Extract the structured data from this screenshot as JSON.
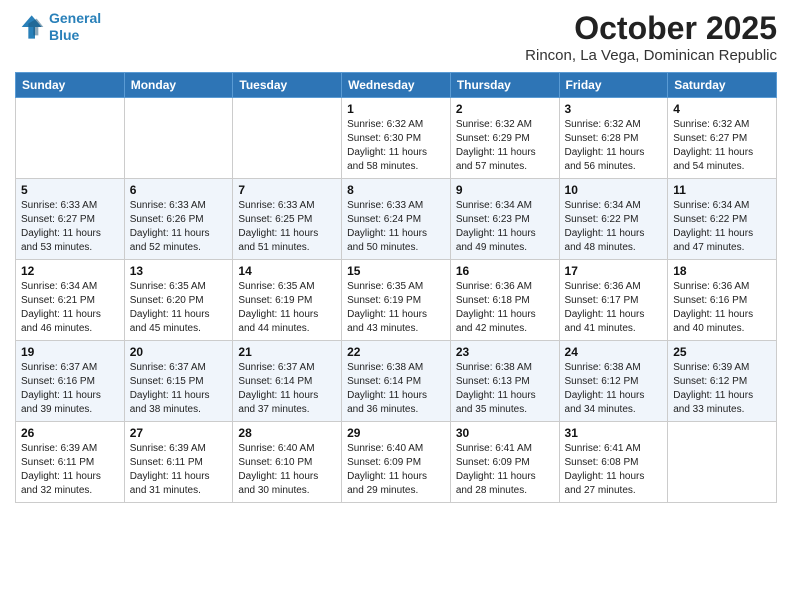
{
  "logo": {
    "line1": "General",
    "line2": "Blue"
  },
  "header": {
    "month": "October 2025",
    "location": "Rincon, La Vega, Dominican Republic"
  },
  "weekdays": [
    "Sunday",
    "Monday",
    "Tuesday",
    "Wednesday",
    "Thursday",
    "Friday",
    "Saturday"
  ],
  "weeks": [
    [
      {
        "day": "",
        "sunrise": "",
        "sunset": "",
        "daylight": ""
      },
      {
        "day": "",
        "sunrise": "",
        "sunset": "",
        "daylight": ""
      },
      {
        "day": "",
        "sunrise": "",
        "sunset": "",
        "daylight": ""
      },
      {
        "day": "1",
        "sunrise": "Sunrise: 6:32 AM",
        "sunset": "Sunset: 6:30 PM",
        "daylight": "Daylight: 11 hours and 58 minutes."
      },
      {
        "day": "2",
        "sunrise": "Sunrise: 6:32 AM",
        "sunset": "Sunset: 6:29 PM",
        "daylight": "Daylight: 11 hours and 57 minutes."
      },
      {
        "day": "3",
        "sunrise": "Sunrise: 6:32 AM",
        "sunset": "Sunset: 6:28 PM",
        "daylight": "Daylight: 11 hours and 56 minutes."
      },
      {
        "day": "4",
        "sunrise": "Sunrise: 6:32 AM",
        "sunset": "Sunset: 6:27 PM",
        "daylight": "Daylight: 11 hours and 54 minutes."
      }
    ],
    [
      {
        "day": "5",
        "sunrise": "Sunrise: 6:33 AM",
        "sunset": "Sunset: 6:27 PM",
        "daylight": "Daylight: 11 hours and 53 minutes."
      },
      {
        "day": "6",
        "sunrise": "Sunrise: 6:33 AM",
        "sunset": "Sunset: 6:26 PM",
        "daylight": "Daylight: 11 hours and 52 minutes."
      },
      {
        "day": "7",
        "sunrise": "Sunrise: 6:33 AM",
        "sunset": "Sunset: 6:25 PM",
        "daylight": "Daylight: 11 hours and 51 minutes."
      },
      {
        "day": "8",
        "sunrise": "Sunrise: 6:33 AM",
        "sunset": "Sunset: 6:24 PM",
        "daylight": "Daylight: 11 hours and 50 minutes."
      },
      {
        "day": "9",
        "sunrise": "Sunrise: 6:34 AM",
        "sunset": "Sunset: 6:23 PM",
        "daylight": "Daylight: 11 hours and 49 minutes."
      },
      {
        "day": "10",
        "sunrise": "Sunrise: 6:34 AM",
        "sunset": "Sunset: 6:22 PM",
        "daylight": "Daylight: 11 hours and 48 minutes."
      },
      {
        "day": "11",
        "sunrise": "Sunrise: 6:34 AM",
        "sunset": "Sunset: 6:22 PM",
        "daylight": "Daylight: 11 hours and 47 minutes."
      }
    ],
    [
      {
        "day": "12",
        "sunrise": "Sunrise: 6:34 AM",
        "sunset": "Sunset: 6:21 PM",
        "daylight": "Daylight: 11 hours and 46 minutes."
      },
      {
        "day": "13",
        "sunrise": "Sunrise: 6:35 AM",
        "sunset": "Sunset: 6:20 PM",
        "daylight": "Daylight: 11 hours and 45 minutes."
      },
      {
        "day": "14",
        "sunrise": "Sunrise: 6:35 AM",
        "sunset": "Sunset: 6:19 PM",
        "daylight": "Daylight: 11 hours and 44 minutes."
      },
      {
        "day": "15",
        "sunrise": "Sunrise: 6:35 AM",
        "sunset": "Sunset: 6:19 PM",
        "daylight": "Daylight: 11 hours and 43 minutes."
      },
      {
        "day": "16",
        "sunrise": "Sunrise: 6:36 AM",
        "sunset": "Sunset: 6:18 PM",
        "daylight": "Daylight: 11 hours and 42 minutes."
      },
      {
        "day": "17",
        "sunrise": "Sunrise: 6:36 AM",
        "sunset": "Sunset: 6:17 PM",
        "daylight": "Daylight: 11 hours and 41 minutes."
      },
      {
        "day": "18",
        "sunrise": "Sunrise: 6:36 AM",
        "sunset": "Sunset: 6:16 PM",
        "daylight": "Daylight: 11 hours and 40 minutes."
      }
    ],
    [
      {
        "day": "19",
        "sunrise": "Sunrise: 6:37 AM",
        "sunset": "Sunset: 6:16 PM",
        "daylight": "Daylight: 11 hours and 39 minutes."
      },
      {
        "day": "20",
        "sunrise": "Sunrise: 6:37 AM",
        "sunset": "Sunset: 6:15 PM",
        "daylight": "Daylight: 11 hours and 38 minutes."
      },
      {
        "day": "21",
        "sunrise": "Sunrise: 6:37 AM",
        "sunset": "Sunset: 6:14 PM",
        "daylight": "Daylight: 11 hours and 37 minutes."
      },
      {
        "day": "22",
        "sunrise": "Sunrise: 6:38 AM",
        "sunset": "Sunset: 6:14 PM",
        "daylight": "Daylight: 11 hours and 36 minutes."
      },
      {
        "day": "23",
        "sunrise": "Sunrise: 6:38 AM",
        "sunset": "Sunset: 6:13 PM",
        "daylight": "Daylight: 11 hours and 35 minutes."
      },
      {
        "day": "24",
        "sunrise": "Sunrise: 6:38 AM",
        "sunset": "Sunset: 6:12 PM",
        "daylight": "Daylight: 11 hours and 34 minutes."
      },
      {
        "day": "25",
        "sunrise": "Sunrise: 6:39 AM",
        "sunset": "Sunset: 6:12 PM",
        "daylight": "Daylight: 11 hours and 33 minutes."
      }
    ],
    [
      {
        "day": "26",
        "sunrise": "Sunrise: 6:39 AM",
        "sunset": "Sunset: 6:11 PM",
        "daylight": "Daylight: 11 hours and 32 minutes."
      },
      {
        "day": "27",
        "sunrise": "Sunrise: 6:39 AM",
        "sunset": "Sunset: 6:11 PM",
        "daylight": "Daylight: 11 hours and 31 minutes."
      },
      {
        "day": "28",
        "sunrise": "Sunrise: 6:40 AM",
        "sunset": "Sunset: 6:10 PM",
        "daylight": "Daylight: 11 hours and 30 minutes."
      },
      {
        "day": "29",
        "sunrise": "Sunrise: 6:40 AM",
        "sunset": "Sunset: 6:09 PM",
        "daylight": "Daylight: 11 hours and 29 minutes."
      },
      {
        "day": "30",
        "sunrise": "Sunrise: 6:41 AM",
        "sunset": "Sunset: 6:09 PM",
        "daylight": "Daylight: 11 hours and 28 minutes."
      },
      {
        "day": "31",
        "sunrise": "Sunrise: 6:41 AM",
        "sunset": "Sunset: 6:08 PM",
        "daylight": "Daylight: 11 hours and 27 minutes."
      },
      {
        "day": "",
        "sunrise": "",
        "sunset": "",
        "daylight": ""
      }
    ]
  ]
}
